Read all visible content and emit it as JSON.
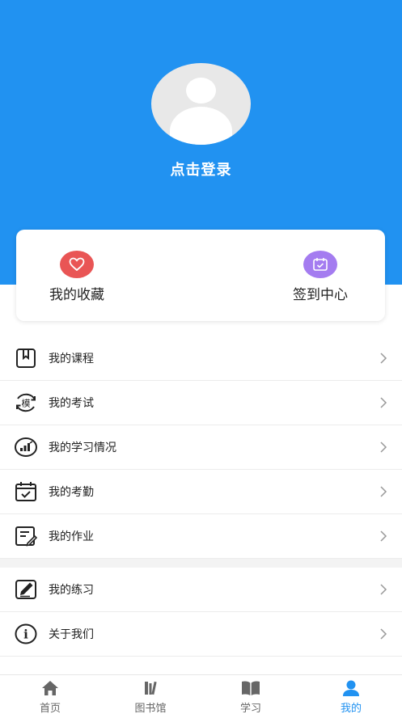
{
  "header": {
    "login_text": "点击登录",
    "bg_color": "#2192f1"
  },
  "quick": {
    "favorites": {
      "label": "我的收藏",
      "icon": "heart-icon",
      "color": "#e95555"
    },
    "checkin": {
      "label": "签到中心",
      "icon": "calendar-check-icon",
      "color": "#a47cf0"
    }
  },
  "menu1": [
    {
      "label": "我的课程",
      "icon": "bookmark-icon"
    },
    {
      "label": "我的考试",
      "icon": "exam-mock-icon",
      "icon_text": "模"
    },
    {
      "label": "我的学习情况",
      "icon": "stats-chart-icon"
    },
    {
      "label": "我的考勤",
      "icon": "attendance-calendar-icon"
    },
    {
      "label": "我的作业",
      "icon": "homework-edit-icon"
    }
  ],
  "menu2": [
    {
      "label": "我的练习",
      "icon": "practice-pencil-icon"
    },
    {
      "label": "关于我们",
      "icon": "info-icon",
      "icon_text": "i"
    }
  ],
  "tabs": [
    {
      "label": "首页",
      "icon": "home-icon"
    },
    {
      "label": "图书馆",
      "icon": "library-icon"
    },
    {
      "label": "学习",
      "icon": "open-book-icon"
    },
    {
      "label": "我的",
      "icon": "user-icon",
      "active": true
    }
  ]
}
